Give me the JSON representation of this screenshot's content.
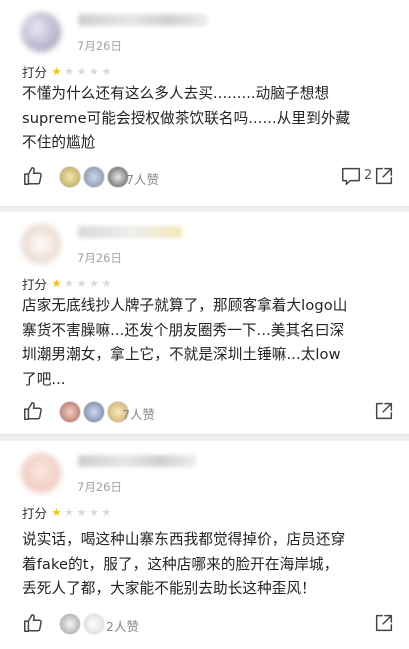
{
  "reviews": [
    {
      "date": "7月26日",
      "rating_label": "打分",
      "stars": 1,
      "lines": [
        "不懂为什么还有这么多人去买.........动脑子想想",
        "supreme可能会授权做茶饮联名吗......从里到外藏",
        "不住的尴尬"
      ],
      "likes": "7人赞",
      "comments": "2",
      "avatar_color": "#c9c6d8"
    },
    {
      "date": "7月26日",
      "rating_label": "打分",
      "stars": 1,
      "lines": [
        "店家无底线抄人牌子就算了，那顾客拿着大logo山",
        "寨货不害臊嘛...还发个朋友圈秀一下...美其名曰深",
        "圳潮男潮女，拿上它，不就是深圳土锤嘛...太low",
        "了吧..."
      ],
      "likes": "7人赞",
      "comments": "",
      "avatar_color": "#e8ddd6"
    },
    {
      "date": "7月26日",
      "rating_label": "打分",
      "stars": 1,
      "lines": [
        "说实话，喝这种山寨东西我都觉得掉价，店员还穿",
        "着fake的t，服了，这种店哪来的脸开在海岸城，",
        "丢死人了都，大家能不能别去助长这种歪风！"
      ],
      "likes": "2人赞",
      "comments": "",
      "avatar_color": "#f0d8cf"
    }
  ]
}
